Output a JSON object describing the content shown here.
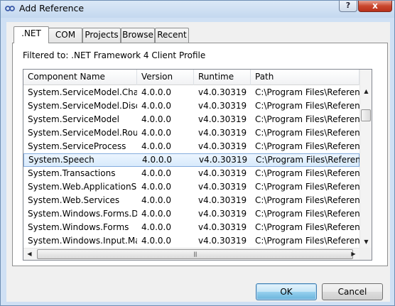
{
  "window": {
    "title": "Add Reference",
    "help_label": "?",
    "close_label": "x"
  },
  "tabs": [
    ".NET",
    "COM",
    "Projects",
    "Browse",
    "Recent"
  ],
  "filter_text": "Filtered to: .NET Framework 4 Client Profile",
  "columns": [
    "Component Name",
    "Version",
    "Runtime",
    "Path"
  ],
  "rows": [
    [
      "System.ServiceModel.Cha...",
      "4.0.0.0",
      "v4.0.30319",
      "C:\\Program Files\\Referen..."
    ],
    [
      "System.ServiceModel.Disc...",
      "4.0.0.0",
      "v4.0.30319",
      "C:\\Program Files\\Referen..."
    ],
    [
      "System.ServiceModel",
      "4.0.0.0",
      "v4.0.30319",
      "C:\\Program Files\\Referen..."
    ],
    [
      "System.ServiceModel.Rout...",
      "4.0.0.0",
      "v4.0.30319",
      "C:\\Program Files\\Referen..."
    ],
    [
      "System.ServiceProcess",
      "4.0.0.0",
      "v4.0.30319",
      "C:\\Program Files\\Referen..."
    ],
    [
      "System.Speech",
      "4.0.0.0",
      "v4.0.30319",
      "C:\\Program Files\\Referen..."
    ],
    [
      "System.Transactions",
      "4.0.0.0",
      "v4.0.30319",
      "C:\\Program Files\\Referen..."
    ],
    [
      "System.Web.ApplicationSe...",
      "4.0.0.0",
      "v4.0.30319",
      "C:\\Program Files\\Referen..."
    ],
    [
      "System.Web.Services",
      "4.0.0.0",
      "v4.0.30319",
      "C:\\Program Files\\Referen..."
    ],
    [
      "System.Windows.Forms.D...",
      "4.0.0.0",
      "v4.0.30319",
      "C:\\Program Files\\Referen..."
    ],
    [
      "System.Windows.Forms",
      "4.0.0.0",
      "v4.0.30319",
      "C:\\Program Files\\Referen..."
    ],
    [
      "System.Windows.Input.Ma...",
      "4.0.0.0",
      "v4.0.30319",
      "C:\\Program Files\\Referen..."
    ]
  ],
  "selected_row_index": 5,
  "buttons": {
    "ok": "OK",
    "cancel": "Cancel"
  },
  "icons": {
    "title": "reference-icon",
    "scroll_up": "arrow-up-icon",
    "scroll_down": "arrow-down-icon",
    "scroll_left": "arrow-left-icon",
    "scroll_right": "arrow-right-icon"
  },
  "colors": {
    "selection_border": "#84acdd",
    "selection_fill": "#d8eafc",
    "frame": "#cfe0f4",
    "close": "#c9462d"
  }
}
